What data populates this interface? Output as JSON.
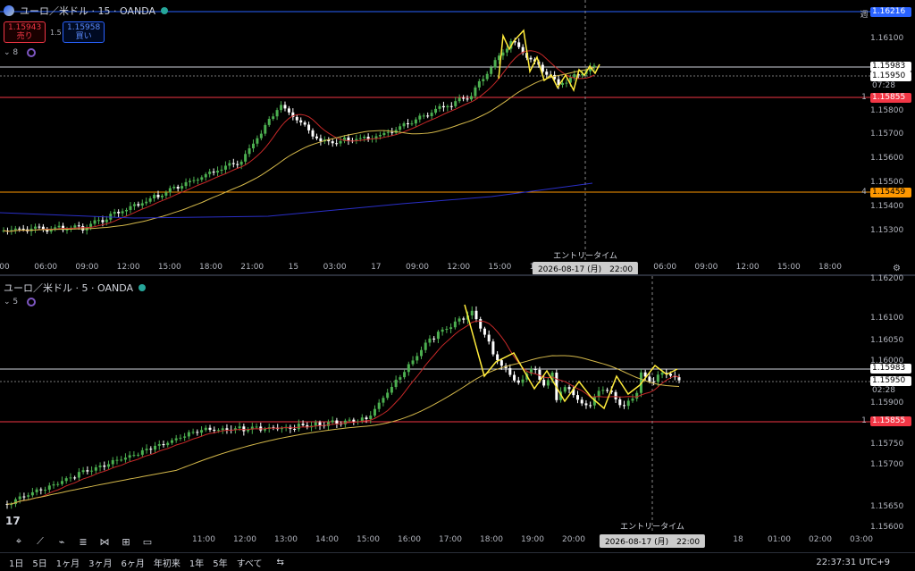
{
  "top": {
    "title": "ユーロ／米ドル · 15 · OANDA",
    "sell_price": "1.15943",
    "sell_label": "売り",
    "buy_price": "1.15958",
    "buy_label": "買い",
    "spread": "1.5",
    "indicator_count": "8",
    "price_axis": [
      "1.16100",
      "1.15950",
      "1.15800",
      "1.15700",
      "1.15600",
      "1.15500",
      "1.15400",
      "1.15300"
    ],
    "price_axis_mid": "1.16000",
    "tag_week": "1.16216",
    "tag_week_label": "週",
    "tag_current": "1.15983",
    "tag_bid": "1.15950",
    "tag_timer": "07:28",
    "tag_red": "1.15855",
    "tag_red_label": "1",
    "tag_orange": "1.15459",
    "tag_orange_label": "4",
    "time_axis": [
      "00",
      "06:00",
      "09:00",
      "12:00",
      "15:00",
      "18:00",
      "21:00",
      "15",
      "03:00",
      "17",
      "09:00",
      "12:00",
      "15:00",
      "18:00",
      "",
      "03:00",
      "06:00",
      "09:00",
      "12:00",
      "15:00",
      "18:00"
    ],
    "crosshair_time": "2026-08-17 (月)　22:00",
    "entry_label": "エントリータイム"
  },
  "bottom": {
    "title": "ユーロ／米ドル · 5 · OANDA",
    "indicator_count": "5",
    "price_axis": [
      "1.16200",
      "1.16100",
      "1.16050",
      "1.16000",
      "1.15900",
      "1.15850",
      "1.15750",
      "1.15700",
      "1.15650",
      "1.15600"
    ],
    "tag_current": "1.15983",
    "tag_bid": "1.15950",
    "tag_timer": "02:28",
    "tag_red": "1.15855",
    "tag_red_label": "1",
    "time_axis": [
      "11:00",
      "12:00",
      "13:00",
      "14:00",
      "15:00",
      "16:00",
      "17:00",
      "18:00",
      "19:00",
      "20:00",
      "2",
      "",
      "00",
      "18",
      "01:00",
      "02:00",
      "03:00"
    ],
    "crosshair_time": "2026-08-17 (月)　22:00",
    "entry_label": "エントリータイム"
  },
  "ranges": [
    "1日",
    "5日",
    "1ヶ月",
    "3ヶ月",
    "6ヶ月",
    "年初来",
    "1年",
    "5年",
    "すべて"
  ],
  "clock": "22:37:31 UTC+9",
  "colors": {
    "up": "#26a69a",
    "down": "#ffffff",
    "candle_up": "#4caf50",
    "ma_red": "#c62828",
    "ma_yellow": "#d4b84a",
    "ma_blue": "#2a2fc8",
    "zigzag": "#ffeb3b",
    "line_white": "#d1d4dc",
    "line_red": "#f23645",
    "line_orange": "#ff9800",
    "line_blue": "#2962ff"
  }
}
